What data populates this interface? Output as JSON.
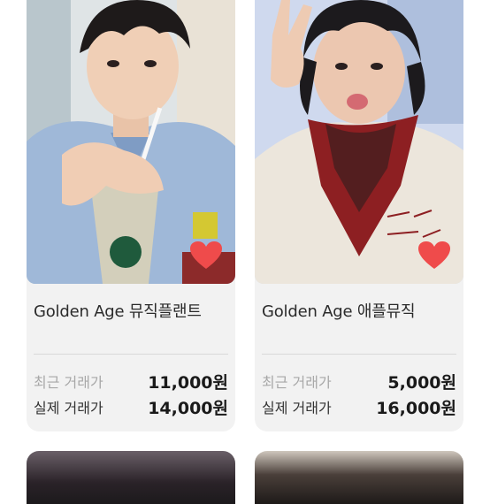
{
  "colors": {
    "card_bg": "#f2f2f2",
    "heart": "#ef4b4b",
    "price_text": "#1a1a1a",
    "recent_label": "#a8a8a8"
  },
  "products": [
    {
      "title": "Golden Age 뮤직플랜트",
      "recent_label": "최근 거래가",
      "recent_price": "11,000원",
      "actual_label": "실제 거래가",
      "actual_price": "14,000원",
      "liked": true
    },
    {
      "title": "Golden Age 애플뮤직",
      "recent_label": "최근 거래가",
      "recent_price": "5,000원",
      "actual_label": "실제 거래가",
      "actual_price": "16,000원",
      "liked": true
    }
  ]
}
